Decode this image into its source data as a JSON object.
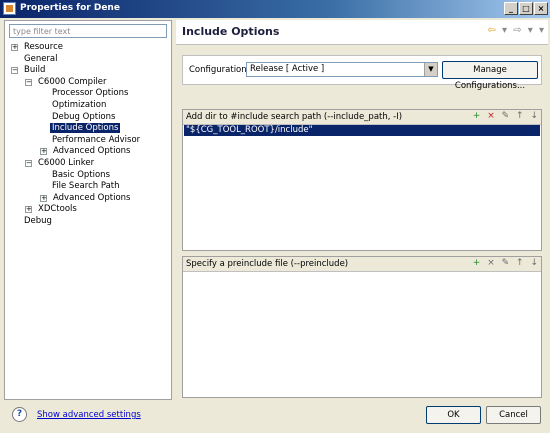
{
  "window": {
    "title": "Properties for Dene",
    "controls": {
      "minimize": "_",
      "maximize": "□",
      "close": "×"
    }
  },
  "sidebar": {
    "filter_placeholder": "type filter text",
    "tree": [
      {
        "label": "Resource",
        "expander": "+"
      },
      {
        "label": "General"
      },
      {
        "label": "Build",
        "expander": "−"
      },
      {
        "label": "C6000 Compiler",
        "expander": "−"
      },
      {
        "label": "Processor Options"
      },
      {
        "label": "Optimization"
      },
      {
        "label": "Debug Options"
      },
      {
        "label": "Include Options",
        "selected": true
      },
      {
        "label": "Performance Advisor"
      },
      {
        "label": "Advanced Options",
        "expander": "+"
      },
      {
        "label": "C6000 Linker",
        "expander": "−"
      },
      {
        "label": "Basic Options"
      },
      {
        "label": "File Search Path"
      },
      {
        "label": "Advanced Options",
        "expander": "+"
      },
      {
        "label": "XDCtools",
        "expander": "+"
      },
      {
        "label": "Debug"
      }
    ]
  },
  "main": {
    "title": "Include Options",
    "nav_icons": {
      "back": "⇦",
      "back_menu": "▾",
      "forward": "⇨",
      "forward_menu": "▾",
      "view_menu": "▾"
    },
    "configuration": {
      "label": "Configuration:",
      "value": "Release  [ Active ]",
      "manage_button": "Manage Configurations..."
    },
    "include_paths": {
      "title": "Add dir to #include search path (--include_path, -I)",
      "items": [
        "\"${CG_TOOL_ROOT}/include\""
      ]
    },
    "preinclude": {
      "title": "Specify a preinclude file (--preinclude)",
      "items": []
    },
    "section_tools": {
      "add": "+",
      "delete": "×",
      "edit": "✎",
      "move_up": "↑",
      "move_down": "↓"
    }
  },
  "footer": {
    "help_icon": "?",
    "advanced_link": "Show advanced settings",
    "ok": "OK",
    "cancel": "Cancel"
  },
  "colors": {
    "selection": "#0a246a",
    "title_gradient_start": "#0a246a",
    "link": "#0000cc"
  }
}
